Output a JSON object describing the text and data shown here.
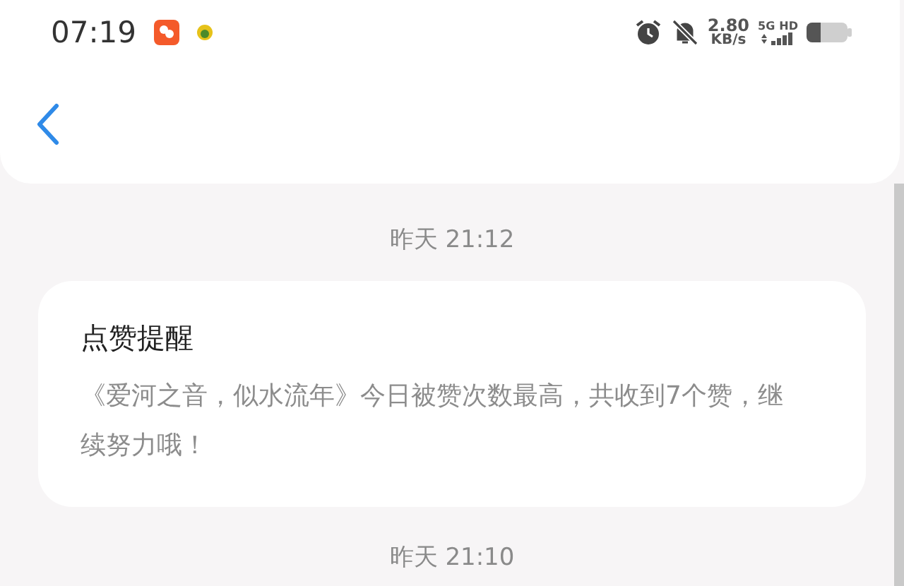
{
  "status_bar": {
    "time": "07:19",
    "speed_value": "2.80",
    "speed_unit": "KB/s",
    "network": "5G",
    "hd": "HD"
  },
  "messages": [
    {
      "kind": "time",
      "text": "昨天 21:12"
    },
    {
      "kind": "card",
      "title": "点赞提醒",
      "body": "《爱河之音，似水流年》今日被赞次数最高，共收到7个赞，继续努力哦！"
    },
    {
      "kind": "time",
      "text": "昨天 21:10"
    }
  ]
}
